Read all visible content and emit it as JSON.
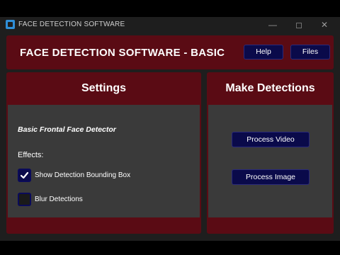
{
  "window": {
    "title": "FACE DETECTION SOFTWARE",
    "controls": {
      "minimize": "—",
      "close": "✕"
    }
  },
  "header": {
    "title": "FACE DETECTION SOFTWARE - BASIC",
    "help_label": "Help",
    "files_label": "Files"
  },
  "settings": {
    "title": "Settings",
    "detector": "Basic Frontal Face Detector",
    "effects_label": "Effects:",
    "options": [
      {
        "label": "Show Detection Bounding Box",
        "checked": true
      },
      {
        "label": "Blur Detections",
        "checked": false
      }
    ]
  },
  "detections": {
    "title": "Make Detections",
    "process_video_label": "Process Video",
    "process_image_label": "Process Image"
  },
  "colors": {
    "accent": "#5a0b14",
    "button": "#0a0a4a",
    "panel_body": "#3a3a3a"
  }
}
